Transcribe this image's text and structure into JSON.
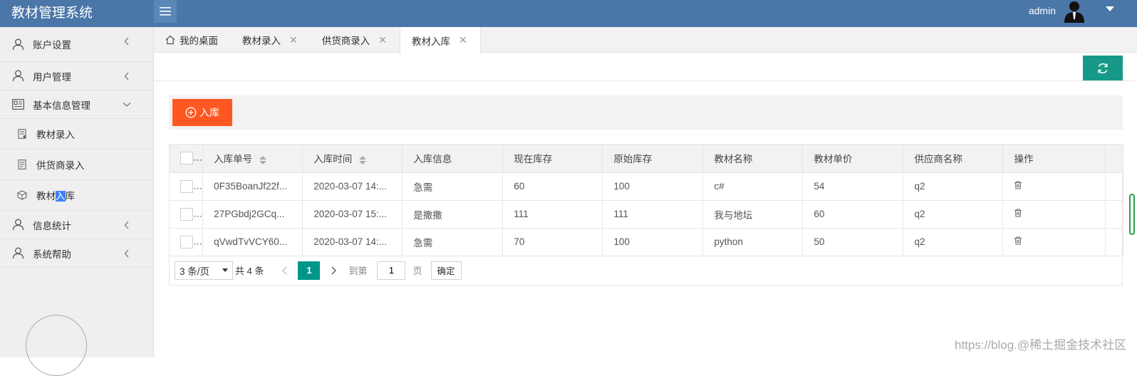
{
  "app": {
    "title": "教材管理系统"
  },
  "header": {
    "user_name": "admin"
  },
  "sidebar": {
    "items": [
      {
        "label": "账户设置",
        "type": "group",
        "expanded": false
      },
      {
        "label": "用户管理",
        "type": "group",
        "expanded": false
      },
      {
        "label": "基本信息管理",
        "type": "group",
        "expanded": true
      },
      {
        "label": "教材录入",
        "type": "sub"
      },
      {
        "label": "供货商录入",
        "type": "sub"
      },
      {
        "label_pre": "教材",
        "label_hl": "入",
        "label_post": "库",
        "type": "sub"
      },
      {
        "label": "信息统计",
        "type": "group",
        "expanded": false
      },
      {
        "label": "系统帮助",
        "type": "group",
        "expanded": false
      }
    ]
  },
  "tabs": [
    {
      "label": "我的桌面",
      "closable": false
    },
    {
      "label": "教材录入",
      "closable": true
    },
    {
      "label": "供货商录入",
      "closable": true
    },
    {
      "label": "教材入库",
      "closable": true,
      "active": true
    }
  ],
  "toolbar": {
    "add_label": "入库"
  },
  "table": {
    "columns": [
      "入库单号",
      "入库时间",
      "入库信息",
      "现在库存",
      "原始库存",
      "教材名称",
      "教材单价",
      "供应商名称",
      "操作"
    ],
    "rows": [
      [
        "0F35BoanJf22f...",
        "2020-03-07 14:...",
        "急需",
        "60",
        "100",
        "c#",
        "54",
        "q2"
      ],
      [
        "27PGbdj2GCq...",
        "2020-03-07 15:...",
        "是撒撒",
        "111",
        "111",
        "我与地坛",
        "60",
        "q2"
      ],
      [
        "qVwdTvVCY60...",
        "2020-03-07 14:...",
        "急需",
        "70",
        "100",
        "python",
        "50",
        "q2"
      ]
    ]
  },
  "pager": {
    "page_size": "3 条/页",
    "total": "共 4 条",
    "current": "1",
    "goto_label": "到第",
    "goto_value": "1",
    "unit": "页",
    "confirm": "确定"
  },
  "watermark": "https://blog.@稀土掘金技术社区",
  "colors": {
    "header": "#4a76a8",
    "add_button": "#ff5722",
    "accent": "#009688",
    "refresh_button": "#169a87"
  }
}
